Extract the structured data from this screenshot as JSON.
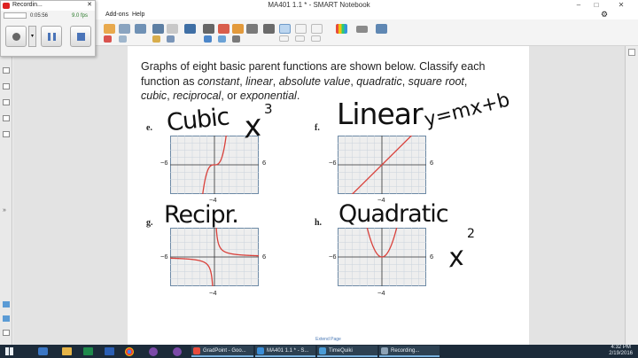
{
  "window": {
    "title": "MA401 1.1 * - SMART Notebook"
  },
  "menu": {
    "items": [
      "Add-ons",
      "Help"
    ]
  },
  "recorder": {
    "title": "Recordin...",
    "elapsed": "0:05:56",
    "fps": "9.0 fps"
  },
  "page": {
    "prompt_line1": "Graphs of eight basic parent functions are shown below. Classify each",
    "prompt_start": "function as ",
    "types": [
      "constant",
      "linear",
      "absolute value",
      "quadratic",
      "square root",
      "cubic",
      "reciprocal",
      "exponential"
    ],
    "sep": ", ",
    "or_word": ", or ",
    "end": ".",
    "footer": "Extend Page"
  },
  "graphs": [
    {
      "letter": "e.",
      "function": "cubic",
      "ticks": {
        "left": "−6",
        "right": "6",
        "bottom": "−4"
      },
      "handwriting": "Cubic",
      "extra_ink": "x",
      "extra_sup": "3"
    },
    {
      "letter": "f.",
      "function": "linear",
      "ticks": {
        "left": "−6",
        "right": "6",
        "bottom": "−4"
      },
      "handwriting": "Linear",
      "extra_ink": "y=mx+b",
      "extra_sup": ""
    },
    {
      "letter": "g.",
      "function": "reciprocal",
      "ticks": {
        "left": "−6",
        "right": "6",
        "bottom": "−4"
      },
      "handwriting": "Recipr.",
      "extra_ink": "",
      "extra_sup": ""
    },
    {
      "letter": "h.",
      "function": "quadratic",
      "ticks": {
        "left": "−6",
        "right": "6",
        "bottom": "−4"
      },
      "handwriting": "Quadratic",
      "extra_ink": "x",
      "extra_sup": "2"
    }
  ],
  "taskbar": {
    "items": [
      {
        "label": "GradPoint - Goo...",
        "icon_color": "#e84c3d"
      },
      {
        "label": "MA401 1.1 * - S...",
        "icon_color": "#3b8ed8"
      },
      {
        "label": "TimeQuiki",
        "icon_color": "#4a9bd6"
      },
      {
        "label": "Recording...",
        "icon_color": "#8da2b5"
      }
    ],
    "time": "4:32 PM",
    "date": "2/19/2016"
  },
  "colors": {
    "curve": "#d9413b",
    "grid_bg": "#eeeeee",
    "grid_line": "#c9d3dc",
    "border": "#6d8aa6"
  }
}
